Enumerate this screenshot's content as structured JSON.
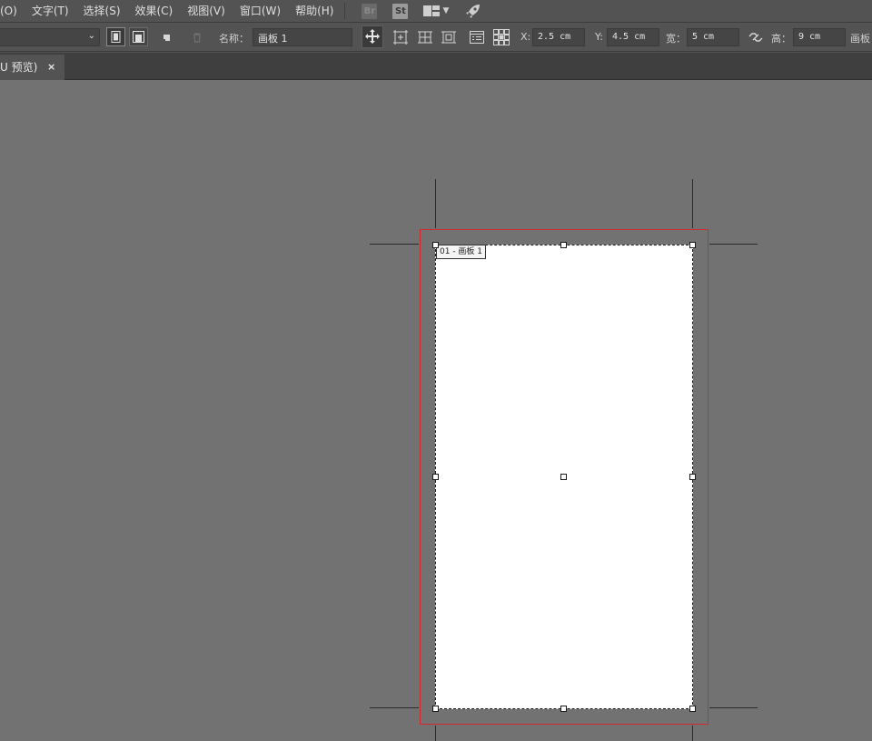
{
  "menubar": {
    "items": [
      "(O)",
      "文字(T)",
      "选择(S)",
      "效果(C)",
      "视图(V)",
      "窗口(W)",
      "帮助(H)"
    ],
    "bridge_badge": "Br",
    "stock_badge": "St"
  },
  "controlbar": {
    "name_label": "名称：",
    "name_value": "画板 1",
    "x_label": "X:",
    "x_value": "2.5 cm",
    "y_label": "Y:",
    "y_value": "4.5 cm",
    "width_label": "宽：",
    "width_value": "5 cm",
    "height_label": "高：",
    "height_value": "9 cm",
    "artboard_label": "画板"
  },
  "tabbar": {
    "tab_label": "U 预览)",
    "close_glyph": "×"
  },
  "canvas": {
    "artboard_label": "01 - 画板 1"
  },
  "colors": {
    "canvas_bg": "#727272",
    "ui_bg": "#535353",
    "bleed_guide": "#d6262e",
    "artboard": "#ffffff"
  }
}
